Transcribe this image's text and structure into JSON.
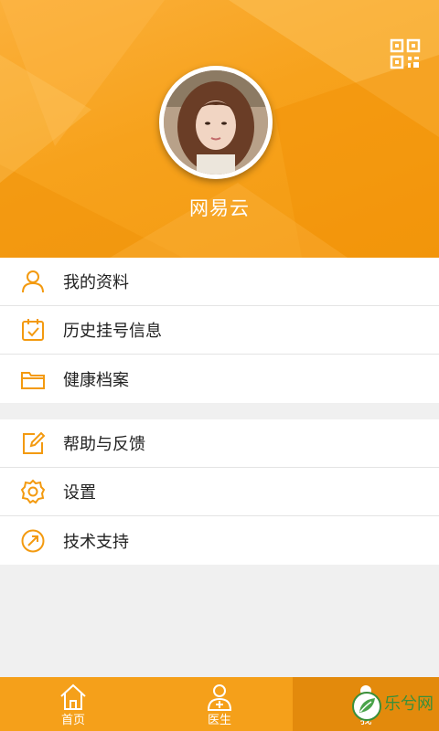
{
  "header": {
    "username": "网易云",
    "qr_icon": "qr-code-icon"
  },
  "profile": {
    "avatar": "user-avatar-photo"
  },
  "menu_group_1": [
    {
      "label": "我的资料",
      "icon": "user-icon"
    },
    {
      "label": "历史挂号信息",
      "icon": "calendar-check-icon"
    },
    {
      "label": "健康档案",
      "icon": "folder-icon"
    }
  ],
  "menu_group_2": [
    {
      "label": "帮助与反馈",
      "icon": "edit-icon"
    },
    {
      "label": "设置",
      "icon": "gear-icon"
    },
    {
      "label": "技术支持",
      "icon": "compass-icon"
    }
  ],
  "tabbar": {
    "tabs": [
      {
        "label": "首页",
        "icon": "home-icon",
        "active": false
      },
      {
        "label": "医生",
        "icon": "doctor-icon",
        "active": false
      },
      {
        "label": "我",
        "icon": "me-icon",
        "active": true
      }
    ]
  },
  "watermark": {
    "text": "乐兮网",
    "logo": "leaf-logo"
  },
  "colors": {
    "accent": "#f7a21c",
    "tab_active": "#e38a0c",
    "icon": "#f39a10"
  }
}
